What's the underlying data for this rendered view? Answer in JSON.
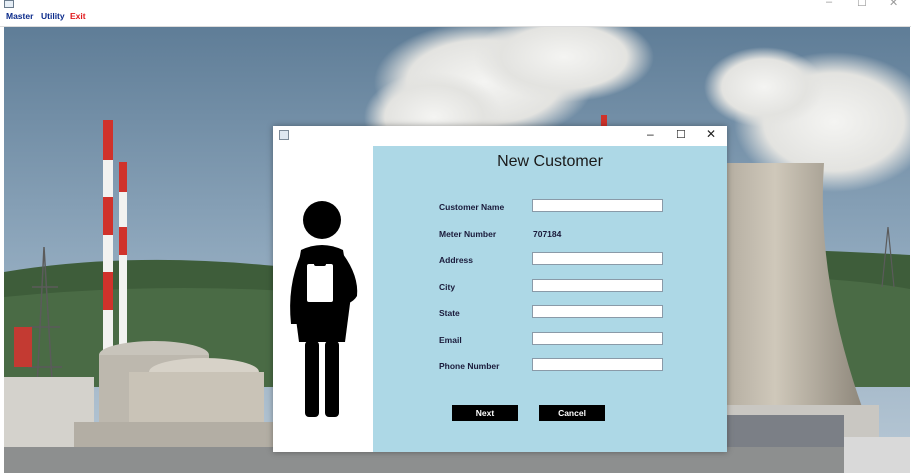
{
  "app": {
    "window_controls": {
      "minimize": "–",
      "maximize": "☐",
      "close": "✕"
    }
  },
  "menubar": {
    "items": [
      {
        "label": "Master",
        "color": "#0a2a8a"
      },
      {
        "label": "Utility",
        "color": "#0a2a8a"
      },
      {
        "label": "Exit",
        "color": "#e0171b"
      }
    ]
  },
  "dialog": {
    "window_controls": {
      "minimize": "–",
      "maximize": "☐",
      "close": "✕"
    },
    "title": "New Customer",
    "panel_color": "#add8e6",
    "fields": [
      {
        "label": "Customer Name",
        "value": ""
      },
      {
        "label": "Meter Number",
        "value": "707184"
      },
      {
        "label": "Address",
        "value": ""
      },
      {
        "label": "City",
        "value": ""
      },
      {
        "label": "State",
        "value": ""
      },
      {
        "label": "Email",
        "value": ""
      },
      {
        "label": "Phone Number",
        "value": ""
      }
    ],
    "buttons": {
      "next": "Next",
      "cancel": "Cancel"
    }
  },
  "icons": {
    "app": "java-app-icon",
    "dialog": "java-app-icon",
    "illustration": "person-with-clipboard-icon"
  }
}
